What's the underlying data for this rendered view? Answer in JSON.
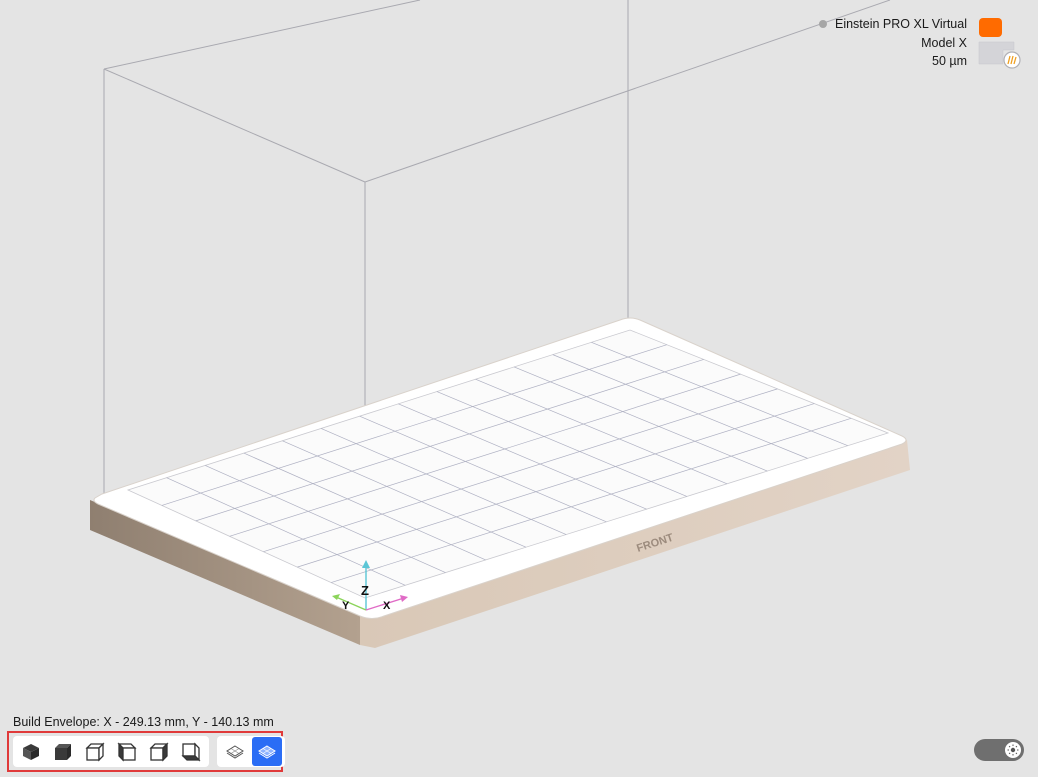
{
  "printer": {
    "name": "Einstein PRO XL Virtual",
    "material": "Model X",
    "layer_thickness": "50 µm",
    "status_color": "#a6a6a6",
    "icon": "printer-resin-icon",
    "accent_color": "#ff6b00"
  },
  "scene": {
    "front_label": "FRONT",
    "axis_labels": {
      "z": "Z",
      "y": "Y",
      "x": "X"
    },
    "axis_colors": {
      "z": "#5bc6d6",
      "y": "#8bd45a",
      "x": "#e06bc6"
    }
  },
  "footer": {
    "build_envelope": "Build Envelope: X - 249.13 mm, Y - 140.13 mm"
  },
  "toolbar": {
    "view_buttons": [
      {
        "name": "view-iso-button",
        "icon": "cube-iso-icon"
      },
      {
        "name": "view-top-button",
        "icon": "cube-top-icon"
      },
      {
        "name": "view-front-button",
        "icon": "cube-front-icon"
      },
      {
        "name": "view-left-button",
        "icon": "cube-left-icon"
      },
      {
        "name": "view-right-button",
        "icon": "cube-right-icon"
      },
      {
        "name": "view-back-button",
        "icon": "cube-back-icon"
      }
    ],
    "layer_buttons": [
      {
        "name": "layers-outline-button",
        "icon": "layers-icon",
        "active": false
      },
      {
        "name": "layers-filled-button",
        "icon": "layers-filled-icon",
        "active": true
      }
    ],
    "active_color": "#2a6df5"
  },
  "theme_toggle": {
    "icon": "sun-icon",
    "track_color": "#6f6f6f"
  }
}
